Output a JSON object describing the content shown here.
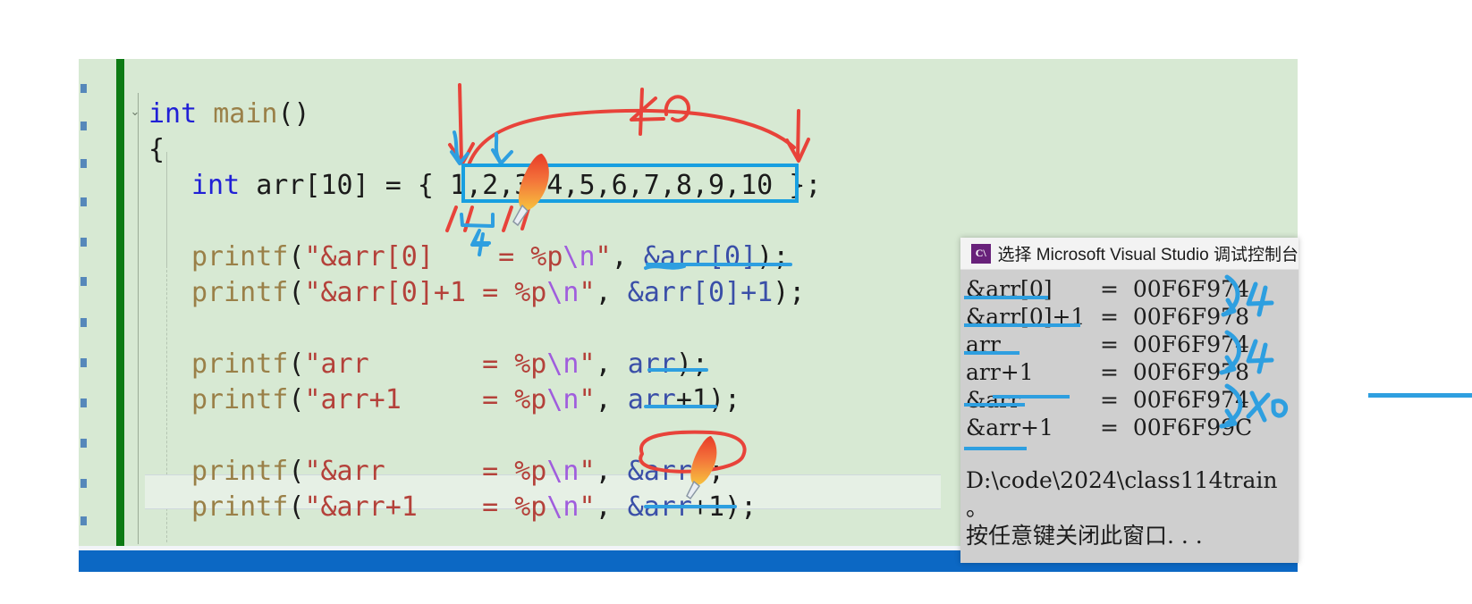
{
  "editor": {
    "window_name": "visual-studio-code-editor",
    "background_color": "#d7e8d3",
    "change_bar_color": "#0d7a14",
    "code_lines": [
      {
        "id": "line-main",
        "indent": 0,
        "tokens": [
          {
            "t": "int ",
            "c": "kw"
          },
          {
            "t": "main",
            "c": "fn"
          },
          {
            "t": "()",
            "c": "plain"
          }
        ]
      },
      {
        "id": "line-open",
        "indent": 0,
        "tokens": [
          {
            "t": "{",
            "c": "plain"
          }
        ]
      },
      {
        "id": "line-arr-decl",
        "indent": 1,
        "tokens": [
          {
            "t": "int ",
            "c": "kw"
          },
          {
            "t": "arr",
            "c": "plain"
          },
          {
            "t": "[",
            "c": "plain"
          },
          {
            "t": "10",
            "c": "num"
          },
          {
            "t": "] = { 1,2,3,4,5,6,7,8,9,10 };",
            "c": "plain"
          }
        ]
      },
      {
        "id": "line-blank-1",
        "indent": 0,
        "tokens": []
      },
      {
        "id": "line-printf-1",
        "indent": 1,
        "tokens": [
          {
            "t": "printf",
            "c": "fn"
          },
          {
            "t": "(",
            "c": "plain"
          },
          {
            "t": "\"&arr[0]    = %p",
            "c": "str"
          },
          {
            "t": "\\n",
            "c": "esc"
          },
          {
            "t": "\"",
            "c": "str"
          },
          {
            "t": ", ",
            "c": "plain"
          },
          {
            "t": "&arr[0]",
            "c": "var"
          },
          {
            "t": ");",
            "c": "plain"
          }
        ]
      },
      {
        "id": "line-printf-2",
        "indent": 1,
        "tokens": [
          {
            "t": "printf",
            "c": "fn"
          },
          {
            "t": "(",
            "c": "plain"
          },
          {
            "t": "\"&arr[0]+1 = %p",
            "c": "str"
          },
          {
            "t": "\\n",
            "c": "esc"
          },
          {
            "t": "\"",
            "c": "str"
          },
          {
            "t": ", ",
            "c": "plain"
          },
          {
            "t": "&arr[0]+1",
            "c": "var"
          },
          {
            "t": ");",
            "c": "plain"
          }
        ]
      },
      {
        "id": "line-blank-2",
        "indent": 0,
        "tokens": []
      },
      {
        "id": "line-printf-3",
        "indent": 1,
        "tokens": [
          {
            "t": "printf",
            "c": "fn"
          },
          {
            "t": "(",
            "c": "plain"
          },
          {
            "t": "\"arr       = %p",
            "c": "str"
          },
          {
            "t": "\\n",
            "c": "esc"
          },
          {
            "t": "\"",
            "c": "str"
          },
          {
            "t": ", ",
            "c": "plain"
          },
          {
            "t": "arr",
            "c": "var"
          },
          {
            "t": ");",
            "c": "plain"
          }
        ]
      },
      {
        "id": "line-printf-4",
        "indent": 1,
        "tokens": [
          {
            "t": "printf",
            "c": "fn"
          },
          {
            "t": "(",
            "c": "plain"
          },
          {
            "t": "\"arr+1     = %p",
            "c": "str"
          },
          {
            "t": "\\n",
            "c": "esc"
          },
          {
            "t": "\"",
            "c": "str"
          },
          {
            "t": ", ",
            "c": "plain"
          },
          {
            "t": "arr",
            "c": "var"
          },
          {
            "t": "+1);",
            "c": "plain"
          }
        ]
      },
      {
        "id": "line-blank-3",
        "indent": 0,
        "tokens": []
      },
      {
        "id": "line-printf-5",
        "indent": 1,
        "tokens": [
          {
            "t": "printf",
            "c": "fn"
          },
          {
            "t": "(",
            "c": "plain"
          },
          {
            "t": "\"&arr      = %p",
            "c": "str"
          },
          {
            "t": "\\n",
            "c": "esc"
          },
          {
            "t": "\"",
            "c": "str"
          },
          {
            "t": ", ",
            "c": "plain"
          },
          {
            "t": "&arr",
            "c": "var"
          },
          {
            "t": ");",
            "c": "plain"
          }
        ]
      },
      {
        "id": "line-printf-6",
        "indent": 1,
        "tokens": [
          {
            "t": "printf",
            "c": "fn"
          },
          {
            "t": "(",
            "c": "plain"
          },
          {
            "t": "\"&arr+1    = %p",
            "c": "str"
          },
          {
            "t": "\\n",
            "c": "esc"
          },
          {
            "t": "\"",
            "c": "str"
          },
          {
            "t": ", ",
            "c": "plain"
          },
          {
            "t": "&arr",
            "c": "var"
          },
          {
            "t": "+1);",
            "c": "plain"
          }
        ]
      }
    ],
    "fold_chevron": "⌄",
    "array_values": [
      "1",
      "2",
      "3",
      "4",
      "5",
      "6",
      "7",
      "8",
      "9",
      "10"
    ]
  },
  "console": {
    "title": "选择 Microsoft Visual Studio 调试控制台",
    "logo_text": "C\\",
    "rows": [
      {
        "label": "&arr[0]",
        "eq": "=",
        "value": "00F6F974",
        "underline": true
      },
      {
        "label": "&arr[0]+1",
        "eq": "=",
        "value": "00F6F978",
        "underline": true
      },
      {
        "label": "arr",
        "eq": "=",
        "value": "00F6F974",
        "underline": true
      },
      {
        "label": "arr+1",
        "eq": "=",
        "value": "00F6F978",
        "underline": false
      },
      {
        "label": "&arr",
        "eq": "=",
        "value": "00F6F974",
        "underline": true
      },
      {
        "label": "&arr+1",
        "eq": "=",
        "value": "00F6F99C",
        "underline": false
      }
    ],
    "path_line": "D:\\code\\2024\\class114train",
    "period_line": "。",
    "prompt_line": "按任意键关闭此窗口. . ."
  },
  "annotations": {
    "ink_red": "#e8433a",
    "ink_blue": "#2e9fe0",
    "array_span_label": "40",
    "element_size_label": "4",
    "console_group_1": "4",
    "console_group_2": "4",
    "console_group_3": "40"
  },
  "status_bar": {
    "color": "#0c68c4"
  }
}
